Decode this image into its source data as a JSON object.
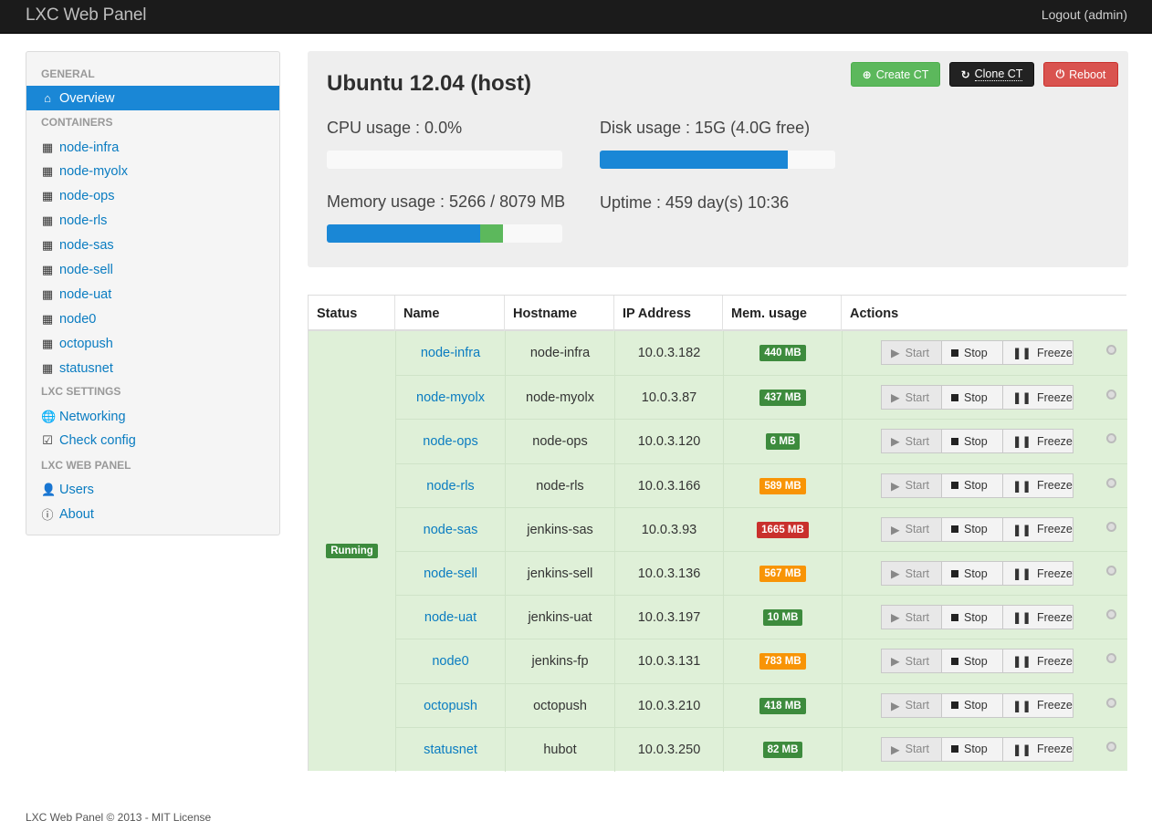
{
  "navbar": {
    "brand": "LXC Web Panel",
    "logout": "Logout (admin)"
  },
  "sidebar": {
    "headers": [
      "GENERAL",
      "CONTAINERS",
      "LXC SETTINGS",
      "LXC WEB PANEL"
    ],
    "overview": "Overview",
    "containers": [
      "node-infra",
      "node-myolx",
      "node-ops",
      "node-rls",
      "node-sas",
      "node-sell",
      "node-uat",
      "node0",
      "octopush",
      "statusnet"
    ],
    "settings": [
      "Networking",
      "Check config"
    ],
    "panel": [
      "Users",
      "About"
    ]
  },
  "host": {
    "title": "Ubuntu 12.04 (host)",
    "cpu_label": "CPU usage : 0.0%",
    "cpu_fraction": 0.0,
    "disk_label": "Disk usage : 15G (4.0G free)",
    "disk_fraction": 0.8,
    "memory_label": "Memory usage : 5266 / 8079 MB",
    "memory_used_fraction": 0.65,
    "memory_cache_fraction": 0.1,
    "uptime_label": "Uptime : 459 day(s) 10:36",
    "buttons": {
      "create": "Create CT",
      "clone": "Clone CT",
      "reboot": "Reboot"
    },
    "colors": {
      "create": "#5cb85c",
      "clone": "#222222",
      "reboot": "#d9534f"
    }
  },
  "table": {
    "headers": [
      "Status",
      "Name",
      "Hostname",
      "IP Address",
      "Mem. usage",
      "Actions"
    ],
    "status": "Running",
    "actions": {
      "start": "Start",
      "stop": "Stop",
      "freeze": "Freeze"
    },
    "rows": [
      {
        "name": "node-infra",
        "hostname": "node-infra",
        "ip": "10.0.3.182",
        "mem": "440 MB",
        "mem_color": "#3d8b3d"
      },
      {
        "name": "node-myolx",
        "hostname": "node-myolx",
        "ip": "10.0.3.87",
        "mem": "437 MB",
        "mem_color": "#3d8b3d"
      },
      {
        "name": "node-ops",
        "hostname": "node-ops",
        "ip": "10.0.3.120",
        "mem": "6 MB",
        "mem_color": "#3d8b3d"
      },
      {
        "name": "node-rls",
        "hostname": "node-rls",
        "ip": "10.0.3.166",
        "mem": "589 MB",
        "mem_color": "#f89406"
      },
      {
        "name": "node-sas",
        "hostname": "jenkins-sas",
        "ip": "10.0.3.93",
        "mem": "1665 MB",
        "mem_color": "#c9302c"
      },
      {
        "name": "node-sell",
        "hostname": "jenkins-sell",
        "ip": "10.0.3.136",
        "mem": "567 MB",
        "mem_color": "#f89406"
      },
      {
        "name": "node-uat",
        "hostname": "jenkins-uat",
        "ip": "10.0.3.197",
        "mem": "10 MB",
        "mem_color": "#3d8b3d"
      },
      {
        "name": "node0",
        "hostname": "jenkins-fp",
        "ip": "10.0.3.131",
        "mem": "783 MB",
        "mem_color": "#f89406"
      },
      {
        "name": "octopush",
        "hostname": "octopush",
        "ip": "10.0.3.210",
        "mem": "418 MB",
        "mem_color": "#3d8b3d"
      },
      {
        "name": "statusnet",
        "hostname": "hubot",
        "ip": "10.0.3.250",
        "mem": "82 MB",
        "mem_color": "#3d8b3d"
      }
    ]
  },
  "footer": "LXC Web Panel © 2013 - MIT License"
}
